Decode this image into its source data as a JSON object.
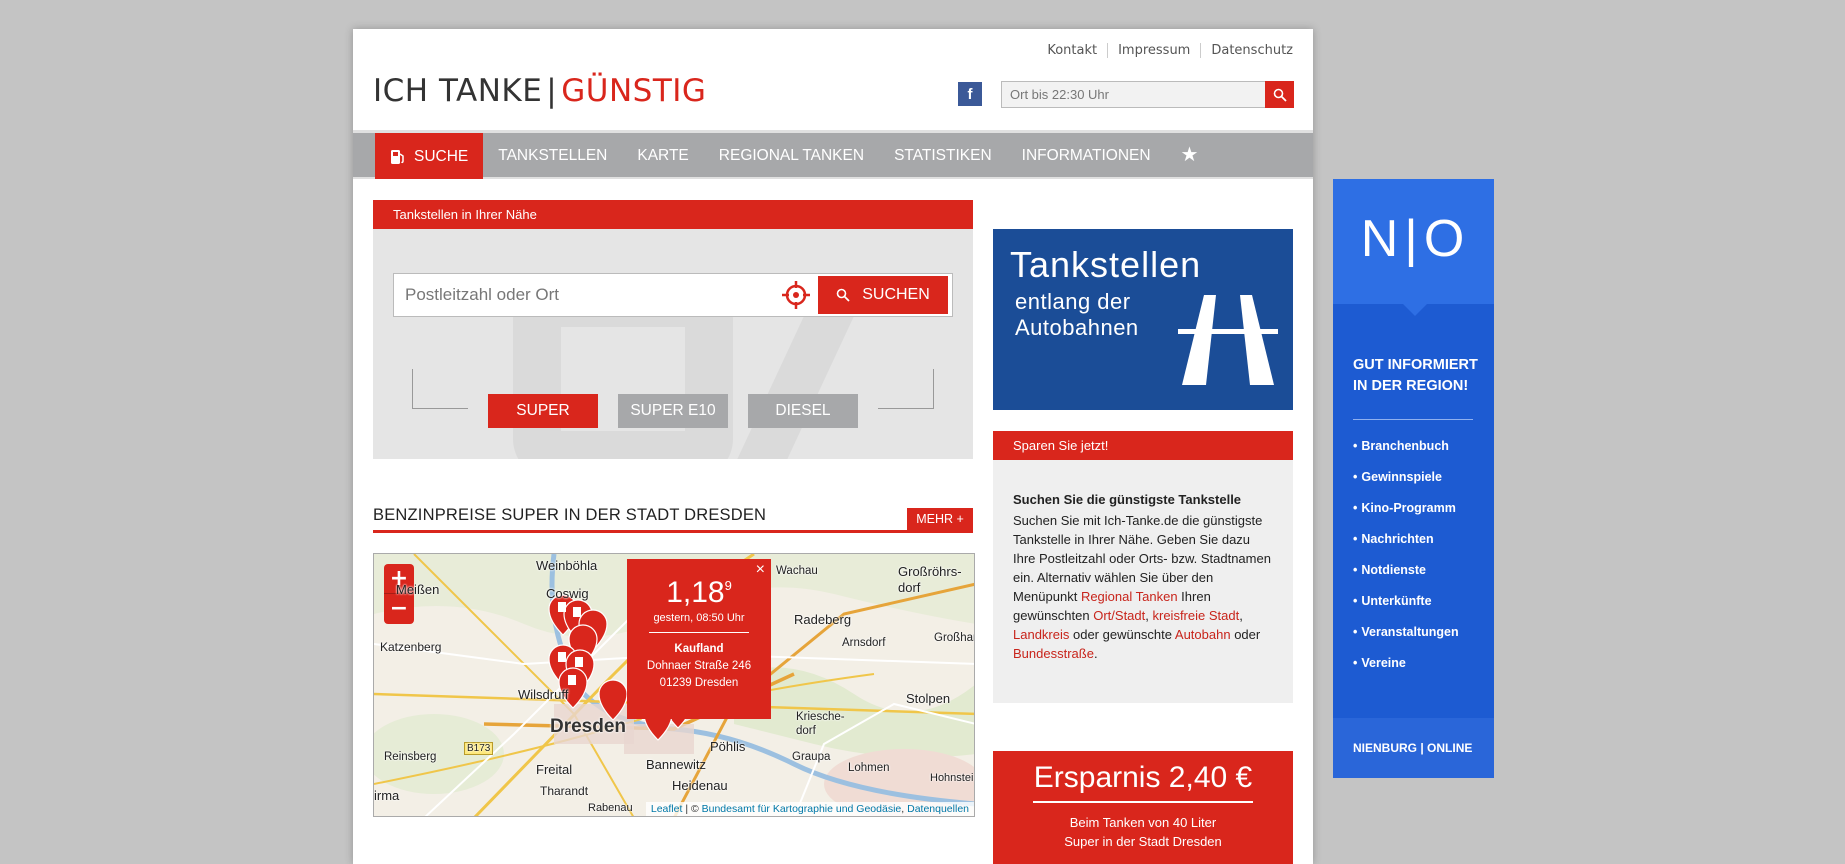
{
  "toplinks": [
    "Kontakt",
    "Impressum",
    "Datenschutz"
  ],
  "logo": {
    "part1": "ICH TANKE",
    "separator": "|",
    "part2": "GÜNSTIG"
  },
  "header_search": {
    "placeholder": "Ort bis 22:30 Uhr",
    "icon": "search-icon"
  },
  "facebook_label": "f",
  "nav": {
    "active_icon": "fuel-pump-icon",
    "items": [
      "SUCHE",
      "TANKSTELLEN",
      "KARTE",
      "REGIONAL TANKEN",
      "STATISTIKEN",
      "INFORMATIONEN"
    ],
    "favorites_icon": "★"
  },
  "nearby": {
    "title": "Tankstellen in Ihrer Nähe",
    "placeholder": "Postleitzahl oder Ort",
    "locate_icon": "crosshair-icon",
    "search_label": "SUCHEN",
    "fuels": [
      "SUPER",
      "SUPER E10",
      "DIESEL"
    ],
    "active_fuel": "SUPER"
  },
  "prices_section": {
    "title": "BENZINPREISE SUPER IN DER STADT DRESDEN",
    "more_label": "MEHR +"
  },
  "map": {
    "zoom_in": "+",
    "zoom_out": "−",
    "towns": [
      "Weinböhla",
      "Coswig",
      "Meißen",
      "Katzenberg",
      "Wilsdruff",
      "Dresden",
      "Freital",
      "Tharandt",
      "Rabenau",
      "Reinsberg",
      "Radeberg",
      "Arnsdorf",
      "Großröhrs-dorf",
      "Großhart",
      "Wachau",
      "Stolpen",
      "Kriesche-dorf",
      "Graupa",
      "Lohmen",
      "Hohnstei",
      "Bannewitz",
      "Heidenau",
      "Pöhlis",
      "B173",
      "irma"
    ],
    "attribution": {
      "leaflet": "Leaflet",
      "sep": " | © ",
      "bkg": "Bundesamt für Kartographie und Geodäsie",
      "comma": ", ",
      "sources": "Datenquellen"
    },
    "popup": {
      "close": "×",
      "price_main": "1,18",
      "price_sup": "9",
      "when": "gestern, 08:50 Uhr",
      "station": "Kaufland",
      "street": "Dohnaer Straße 246",
      "city": "01239 Dresden"
    }
  },
  "autobahn_ad": {
    "line1": "Tankstellen",
    "line2": "entlang der",
    "line3": "Autobahnen"
  },
  "sparen": {
    "title": "Sparen Sie jetzt!",
    "heading": "Suchen Sie die günstigste Tankstelle",
    "text1": "Suchen Sie mit Ich-Tanke.de die günstigste Tankstelle in Ihrer Nähe. Geben Sie dazu Ihre Postleitzahl oder Orts- bzw. Stadtnamen ein. Alternativ wählen Sie über den Menüpunkt ",
    "link1": "Regional Tanken",
    "text2": " Ihren gewünschten ",
    "link2": "Ort/Stadt",
    "text3": ", ",
    "link3": "kreisfreie Stadt",
    "text4": ", ",
    "link4": "Landkreis",
    "text5": " oder gewünschte ",
    "link5": "Autobahn",
    "text6": " oder ",
    "link6": "Bundesstraße",
    "text7": "."
  },
  "ersparnis": {
    "title": "Ersparnis 2,40 €",
    "line1": "Beim Tanken von 40 Liter",
    "line2": "Super in der Stadt Dresden"
  },
  "banner": {
    "logo_left": "N",
    "logo_sep": "|",
    "logo_right": "O",
    "claim1": "GUT INFORMIERT",
    "claim2": "IN DER REGION!",
    "items": [
      "Branchenbuch",
      "Gewinnspiele",
      "Kino-Programm",
      "Nachrichten",
      "Notdienste",
      "Unterkünfte",
      "Veranstaltungen",
      "Vereine"
    ],
    "footer": "NIENBURG | ONLINE"
  },
  "colors": {
    "accent": "#d9261c",
    "nav": "#a7a8aa",
    "autobahn_blue": "#1b4d97",
    "banner_blue": "#1d5bd2"
  }
}
